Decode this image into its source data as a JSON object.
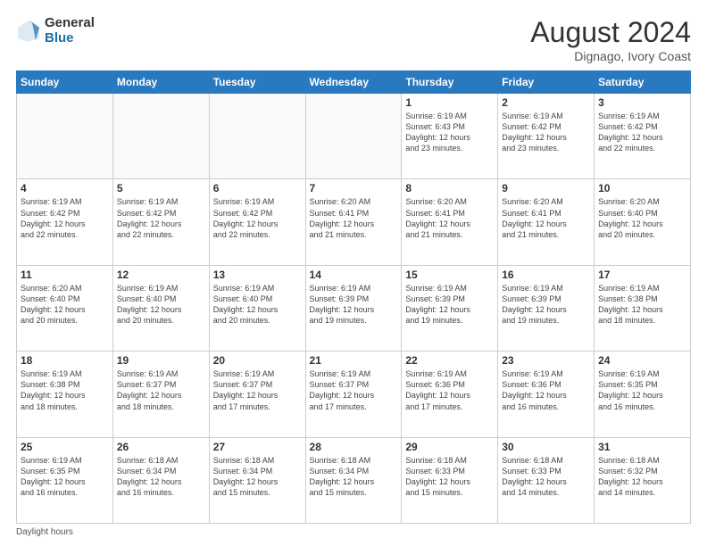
{
  "header": {
    "logo_general": "General",
    "logo_blue": "Blue",
    "month_year": "August 2024",
    "location": "Dignago, Ivory Coast"
  },
  "footer": {
    "daylight_label": "Daylight hours"
  },
  "weekdays": [
    "Sunday",
    "Monday",
    "Tuesday",
    "Wednesday",
    "Thursday",
    "Friday",
    "Saturday"
  ],
  "weeks": [
    [
      {
        "day": "",
        "info": ""
      },
      {
        "day": "",
        "info": ""
      },
      {
        "day": "",
        "info": ""
      },
      {
        "day": "",
        "info": ""
      },
      {
        "day": "1",
        "info": "Sunrise: 6:19 AM\nSunset: 6:43 PM\nDaylight: 12 hours\nand 23 minutes."
      },
      {
        "day": "2",
        "info": "Sunrise: 6:19 AM\nSunset: 6:42 PM\nDaylight: 12 hours\nand 23 minutes."
      },
      {
        "day": "3",
        "info": "Sunrise: 6:19 AM\nSunset: 6:42 PM\nDaylight: 12 hours\nand 22 minutes."
      }
    ],
    [
      {
        "day": "4",
        "info": "Sunrise: 6:19 AM\nSunset: 6:42 PM\nDaylight: 12 hours\nand 22 minutes."
      },
      {
        "day": "5",
        "info": "Sunrise: 6:19 AM\nSunset: 6:42 PM\nDaylight: 12 hours\nand 22 minutes."
      },
      {
        "day": "6",
        "info": "Sunrise: 6:19 AM\nSunset: 6:42 PM\nDaylight: 12 hours\nand 22 minutes."
      },
      {
        "day": "7",
        "info": "Sunrise: 6:20 AM\nSunset: 6:41 PM\nDaylight: 12 hours\nand 21 minutes."
      },
      {
        "day": "8",
        "info": "Sunrise: 6:20 AM\nSunset: 6:41 PM\nDaylight: 12 hours\nand 21 minutes."
      },
      {
        "day": "9",
        "info": "Sunrise: 6:20 AM\nSunset: 6:41 PM\nDaylight: 12 hours\nand 21 minutes."
      },
      {
        "day": "10",
        "info": "Sunrise: 6:20 AM\nSunset: 6:40 PM\nDaylight: 12 hours\nand 20 minutes."
      }
    ],
    [
      {
        "day": "11",
        "info": "Sunrise: 6:20 AM\nSunset: 6:40 PM\nDaylight: 12 hours\nand 20 minutes."
      },
      {
        "day": "12",
        "info": "Sunrise: 6:19 AM\nSunset: 6:40 PM\nDaylight: 12 hours\nand 20 minutes."
      },
      {
        "day": "13",
        "info": "Sunrise: 6:19 AM\nSunset: 6:40 PM\nDaylight: 12 hours\nand 20 minutes."
      },
      {
        "day": "14",
        "info": "Sunrise: 6:19 AM\nSunset: 6:39 PM\nDaylight: 12 hours\nand 19 minutes."
      },
      {
        "day": "15",
        "info": "Sunrise: 6:19 AM\nSunset: 6:39 PM\nDaylight: 12 hours\nand 19 minutes."
      },
      {
        "day": "16",
        "info": "Sunrise: 6:19 AM\nSunset: 6:39 PM\nDaylight: 12 hours\nand 19 minutes."
      },
      {
        "day": "17",
        "info": "Sunrise: 6:19 AM\nSunset: 6:38 PM\nDaylight: 12 hours\nand 18 minutes."
      }
    ],
    [
      {
        "day": "18",
        "info": "Sunrise: 6:19 AM\nSunset: 6:38 PM\nDaylight: 12 hours\nand 18 minutes."
      },
      {
        "day": "19",
        "info": "Sunrise: 6:19 AM\nSunset: 6:37 PM\nDaylight: 12 hours\nand 18 minutes."
      },
      {
        "day": "20",
        "info": "Sunrise: 6:19 AM\nSunset: 6:37 PM\nDaylight: 12 hours\nand 17 minutes."
      },
      {
        "day": "21",
        "info": "Sunrise: 6:19 AM\nSunset: 6:37 PM\nDaylight: 12 hours\nand 17 minutes."
      },
      {
        "day": "22",
        "info": "Sunrise: 6:19 AM\nSunset: 6:36 PM\nDaylight: 12 hours\nand 17 minutes."
      },
      {
        "day": "23",
        "info": "Sunrise: 6:19 AM\nSunset: 6:36 PM\nDaylight: 12 hours\nand 16 minutes."
      },
      {
        "day": "24",
        "info": "Sunrise: 6:19 AM\nSunset: 6:35 PM\nDaylight: 12 hours\nand 16 minutes."
      }
    ],
    [
      {
        "day": "25",
        "info": "Sunrise: 6:19 AM\nSunset: 6:35 PM\nDaylight: 12 hours\nand 16 minutes."
      },
      {
        "day": "26",
        "info": "Sunrise: 6:18 AM\nSunset: 6:34 PM\nDaylight: 12 hours\nand 16 minutes."
      },
      {
        "day": "27",
        "info": "Sunrise: 6:18 AM\nSunset: 6:34 PM\nDaylight: 12 hours\nand 15 minutes."
      },
      {
        "day": "28",
        "info": "Sunrise: 6:18 AM\nSunset: 6:34 PM\nDaylight: 12 hours\nand 15 minutes."
      },
      {
        "day": "29",
        "info": "Sunrise: 6:18 AM\nSunset: 6:33 PM\nDaylight: 12 hours\nand 15 minutes."
      },
      {
        "day": "30",
        "info": "Sunrise: 6:18 AM\nSunset: 6:33 PM\nDaylight: 12 hours\nand 14 minutes."
      },
      {
        "day": "31",
        "info": "Sunrise: 6:18 AM\nSunset: 6:32 PM\nDaylight: 12 hours\nand 14 minutes."
      }
    ]
  ]
}
